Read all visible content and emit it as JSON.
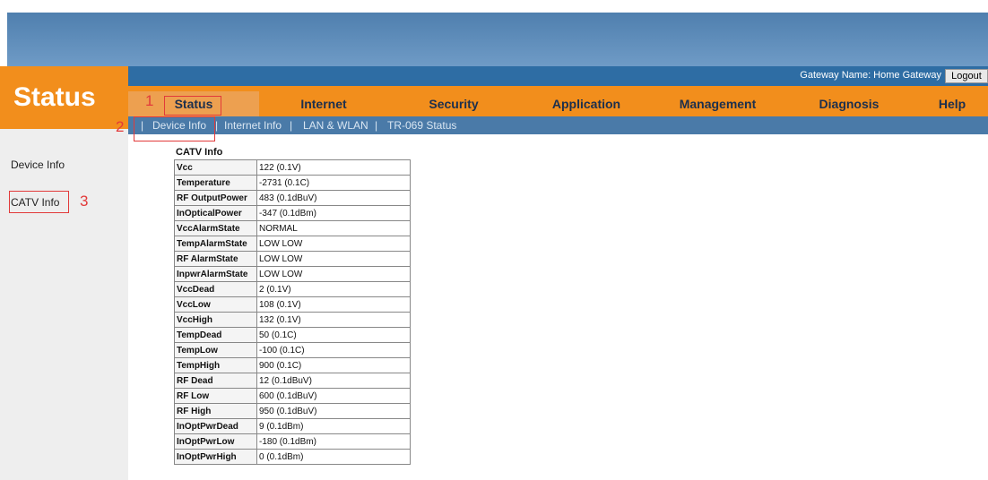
{
  "header": {
    "section_title": "Status",
    "gateway_name": "Gateway Name: Home Gateway",
    "logout_label": "Logout"
  },
  "nav": {
    "tabs": [
      {
        "label": "Status",
        "active": true
      },
      {
        "label": "Internet"
      },
      {
        "label": "Security"
      },
      {
        "label": "Application"
      },
      {
        "label": "Management"
      },
      {
        "label": "Diagnosis"
      },
      {
        "label": "Help"
      }
    ]
  },
  "subnav": {
    "items": [
      "Device Info",
      "Internet Info",
      "LAN & WLAN",
      "TR-069 Status"
    ],
    "separator": "|"
  },
  "sidebar": {
    "items": [
      {
        "label": "Device Info"
      },
      {
        "label": "CATV Info"
      }
    ]
  },
  "annotations": [
    "1",
    "2",
    "3"
  ],
  "catv": {
    "title": "CATV Info",
    "rows": [
      {
        "key": "Vcc",
        "value": "122 (0.1V)"
      },
      {
        "key": "Temperature",
        "value": "-2731 (0.1C)"
      },
      {
        "key": "RF OutputPower",
        "value": "483 (0.1dBuV)"
      },
      {
        "key": "InOpticalPower",
        "value": "-347 (0.1dBm)"
      },
      {
        "key": "VccAlarmState",
        "value": "NORMAL"
      },
      {
        "key": "TempAlarmState",
        "value": "LOW LOW"
      },
      {
        "key": "RF AlarmState",
        "value": "LOW LOW"
      },
      {
        "key": "InpwrAlarmState",
        "value": "LOW LOW"
      },
      {
        "key": "VccDead",
        "value": "2 (0.1V)"
      },
      {
        "key": "VccLow",
        "value": "108 (0.1V)"
      },
      {
        "key": "VccHigh",
        "value": "132 (0.1V)"
      },
      {
        "key": "TempDead",
        "value": "50 (0.1C)"
      },
      {
        "key": "TempLow",
        "value": "-100 (0.1C)"
      },
      {
        "key": "TempHigh",
        "value": "900 (0.1C)"
      },
      {
        "key": "RF Dead",
        "value": "12 (0.1dBuV)"
      },
      {
        "key": "RF Low",
        "value": "600 (0.1dBuV)"
      },
      {
        "key": "RF High",
        "value": "950 (0.1dBuV)"
      },
      {
        "key": "InOptPwrDead",
        "value": "9 (0.1dBm)"
      },
      {
        "key": "InOptPwrLow",
        "value": "-180 (0.1dBm)"
      },
      {
        "key": "InOptPwrHigh",
        "value": "0 (0.1dBm)"
      }
    ]
  },
  "colors": {
    "accent_orange": "#f28e1c",
    "header_blue": "#2e6da4",
    "annotation_red": "#e23a3a"
  }
}
